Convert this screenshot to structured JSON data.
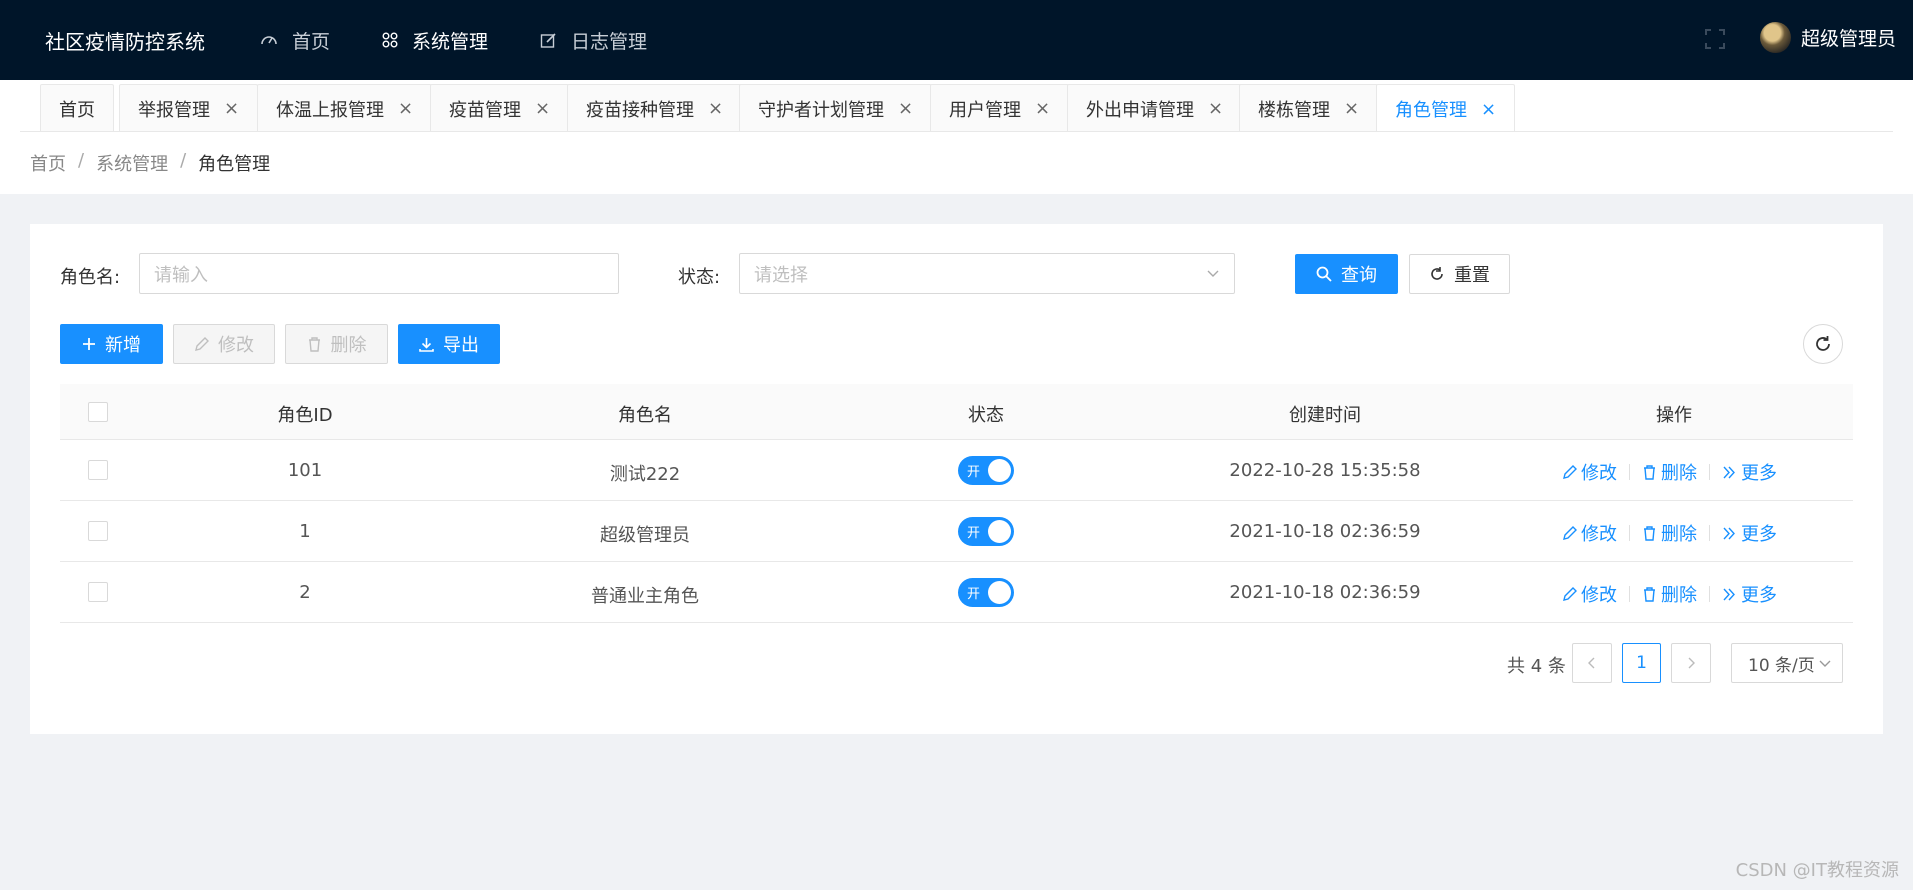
{
  "header": {
    "title": "社区疫情防控系统",
    "nav": [
      {
        "label": "首页",
        "icon": "dashboard-icon"
      },
      {
        "label": "系统管理",
        "icon": "apps-icon",
        "active": true
      },
      {
        "label": "日志管理",
        "icon": "edit-log-icon"
      }
    ],
    "user": "超级管理员"
  },
  "tabs": [
    {
      "label": "首页"
    },
    {
      "label": "举报管理"
    },
    {
      "label": "体温上报管理"
    },
    {
      "label": "疫苗管理"
    },
    {
      "label": "疫苗接种管理"
    },
    {
      "label": "守护者计划管理"
    },
    {
      "label": "用户管理"
    },
    {
      "label": "外出申请管理"
    },
    {
      "label": "楼栋管理"
    },
    {
      "label": "角色管理"
    }
  ],
  "breadcrumb": {
    "home": "首页",
    "parent": "系统管理",
    "current": "角色管理",
    "sep": "/"
  },
  "search": {
    "role_name_label": "角色名:",
    "role_name_placeholder": "请输入",
    "status_label": "状态:",
    "status_placeholder": "请选择",
    "query": "查询",
    "reset": "重置"
  },
  "toolbar": {
    "add": "新增",
    "edit": "修改",
    "delete": "删除",
    "export": "导出"
  },
  "table": {
    "columns": [
      "角色ID",
      "角色名",
      "状态",
      "创建时间",
      "操作"
    ],
    "rows": [
      {
        "id": "101",
        "name": "测试222",
        "status": "开",
        "created": "2022-10-28 15:35:58"
      },
      {
        "id": "1",
        "name": "超级管理员",
        "status": "开",
        "created": "2021-10-18 02:36:59"
      },
      {
        "id": "2",
        "name": "普通业主角色",
        "status": "开",
        "created": "2021-10-18 02:36:59"
      }
    ],
    "ops": {
      "edit": "修改",
      "delete": "删除",
      "more": "更多"
    }
  },
  "pagination": {
    "total": "共 4 条",
    "page": "1",
    "page_size": "10 条/页"
  },
  "watermark": "CSDN @IT教程资源",
  "colors": {
    "header_bg": "#001529",
    "primary": "#1890ff",
    "page_bg": "#f0f2f5"
  }
}
